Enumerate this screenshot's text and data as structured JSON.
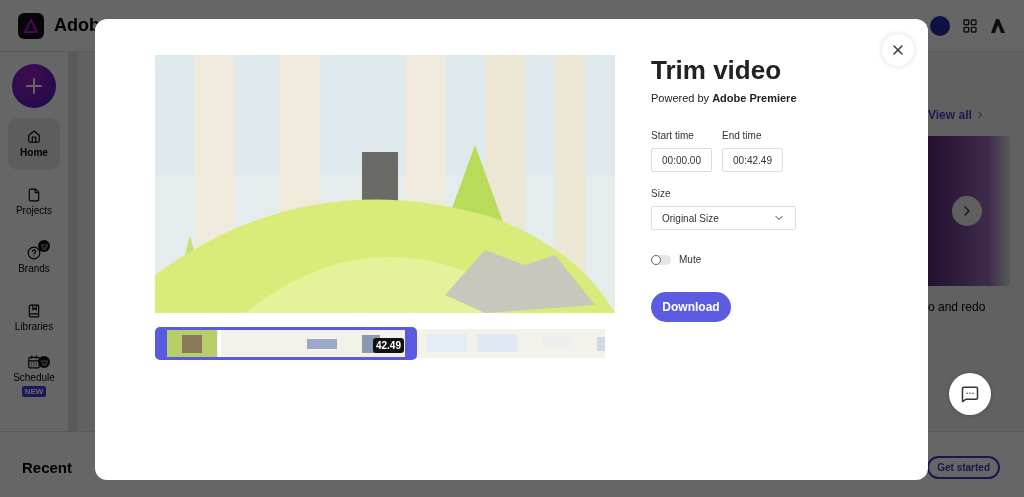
{
  "app": {
    "brand": "Adob",
    "sidebar": {
      "items": [
        {
          "kind": "home",
          "label": "Home",
          "selected": true
        },
        {
          "kind": "projects",
          "label": "Projects",
          "selected": false
        },
        {
          "kind": "brands",
          "label": "Brands",
          "selected": false
        },
        {
          "kind": "libraries",
          "label": "Libraries",
          "selected": false
        },
        {
          "kind": "schedule",
          "label": "Schedule",
          "selected": false,
          "badge": "NEW"
        }
      ]
    },
    "view_all": "View all",
    "card_caption": "o and redo",
    "section_title": "Recent",
    "get_started": "Get started"
  },
  "dialog": {
    "title": "Trim video",
    "subtitle": "Powered by **Adobe Premiere**",
    "start_time": {
      "label": "Start time",
      "value": "00:00.00"
    },
    "end_time": {
      "label": "End time",
      "value": "00:42.49"
    },
    "size": {
      "label": "Size",
      "value": "Original Size"
    },
    "mute": {
      "label": "Mute",
      "on": false
    },
    "download": "Download",
    "timeline": {
      "selection_label": "42.49"
    }
  }
}
